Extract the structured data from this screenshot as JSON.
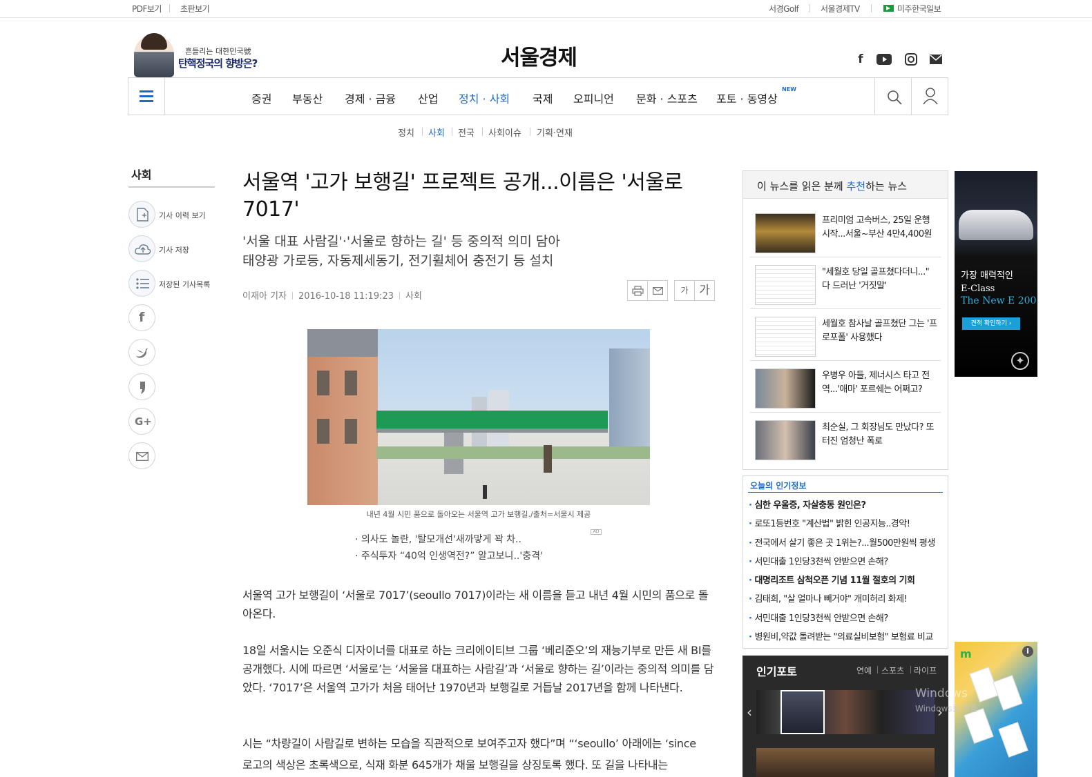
{
  "topbar": {
    "left_links": [
      "PDF보기",
      "초판보기"
    ],
    "right_links": [
      "서경Golf",
      "서울경제TV",
      "미주한국일보"
    ]
  },
  "header": {
    "promo_line1": "흔들리는 대한민국號",
    "promo_line2": "탄핵정국의 향방은?",
    "logo": "서울경제",
    "social_icons": [
      "facebook-icon",
      "youtube-icon",
      "instagram-icon",
      "mail-icon"
    ]
  },
  "gnb": {
    "items": [
      "증권",
      "부동산",
      "경제 · 금융",
      "산업",
      "정치 · 사회",
      "국제",
      "오피니언",
      "문화 · 스포츠",
      "포토 · 동영상"
    ],
    "active": "정치 · 사회",
    "new_badge": "NEW"
  },
  "submenu": {
    "items": [
      "정치",
      "사회",
      "전국",
      "사회이슈",
      "기획·연재"
    ],
    "active": "사회"
  },
  "rail": {
    "section": "사회",
    "actions": [
      "기사 이력 보기",
      "기사 저장",
      "저장된 기사목록"
    ],
    "share_icons": [
      "facebook-icon",
      "twitter-icon",
      "story-icon",
      "google-plus-icon",
      "email-icon"
    ]
  },
  "article": {
    "title": "서울역 '고가 보행길' 프로젝트 공개...이름은 '서울로 7017'",
    "subtitle_lines": [
      "'서울 대표 사람길'·'서울로 향하는 길' 등 중의적 의미 담아",
      "태양광 가로등, 자동제세동기, 전기휠체어 충전기 등 설치"
    ],
    "author": "이재아 기자",
    "date": "2016-10-18 11:19:23",
    "section": "사회",
    "font_small": "가",
    "font_large": "가",
    "photo_caption": "내년 4월 시민 품으로 돌아오는 서울역 고가 보행길./출처=서울시 제공",
    "related": [
      "· 의사도 놀란, '탈모개선'새까맣게 꽉 차..",
      "· 주식투자 “40억 인생역전?” 알고보니..'충격'"
    ],
    "ad_tag": "AD",
    "paragraphs": [
      "서울역 고가 보행길이 ‘서울로 7017’(seoullo 7017)이라는 새 이름을 듣고 내년 4월 시민의 품으로 돌아온다.",
      "18일 서울시는 오준식 디자이너를 대표로 하는 크리에이티브 그룹 ‘베리준오’의 재능기부로 만든 새 BI를 공개했다. 시에 따르면 ‘서울로’는 ‘서울을 대표하는 사람길’과 ‘서울로 향하는 길’이라는 중의적 의미를 담았다. ‘7017’은 서울역 고가가 처음 태어난 1970년과 보행길로 거듭날 2017년을 함께 나타낸다.",
      "시는 “차량길이 사람길로 변하는 모습을 직관적으로 보여주고자 했다”며 “‘seoullo’ 아래에는 ‘since",
      "로고의 색상은 초록색으로, 식재 화분 645개가 채울 보행길을 상징토록 했다. 또 길을 나타내는"
    ]
  },
  "recommend": {
    "title_pre": "이 뉴스를 읽은 분께 ",
    "title_hl": "추천",
    "title_post": "하는 뉴스",
    "items": [
      "프리미엄 고속버스, 25일 운행 시작...서울~부산 4만4,400원",
      "\"세월호 당일 골프쳤다더니...\" 다 드러난 '거짓말'",
      "세월호 참사날 골프쳤단 그는 '프로포폴' 사용했다",
      "우병우 아들, 제너시스 타고 전역...'애마' 포르쉐는 어쩌고?",
      "최순실, 그 회장님도 만났다? 또 터진 엄청난 폭로"
    ]
  },
  "popular": {
    "title": "오늘의 인기정보",
    "items": [
      "심한 우울증, 자살충동 원인은?",
      "로또1등번호 \"계산법\" 밝힌 인공지능..경악!",
      "전국에서 살기 좋은 곳 1위는?...월500만원씩 평생",
      "서민대출 1인당3천씩 안받으면 손해?",
      "대명리조트 삼척오픈 기념 11월 절호의 기회",
      "김태희, \"살 얼마나 빼거야\" 개미허리 화제!",
      "서민대출 1인당3천씩 안받으면 손해?",
      "병원비,약값 돌려받는 \"의료실비보험\" 보험료 비교"
    ],
    "bold_indexes": [
      0,
      4
    ]
  },
  "photo_box": {
    "title": "인기포토",
    "categories": [
      "연예",
      "스포츠",
      "라이프"
    ]
  },
  "ad1": {
    "line1": "가장 매력적인",
    "line2": "E-Class",
    "line3": "The New E 200",
    "button": "견적 확인하기 ›"
  },
  "ad2": {
    "brand": "m",
    "info": "i"
  },
  "os_watermark": {
    "line1": "Windows",
    "line2": "Windows를 정품"
  },
  "colors": {
    "accent": "#1f6bc4",
    "text": "#222222"
  }
}
